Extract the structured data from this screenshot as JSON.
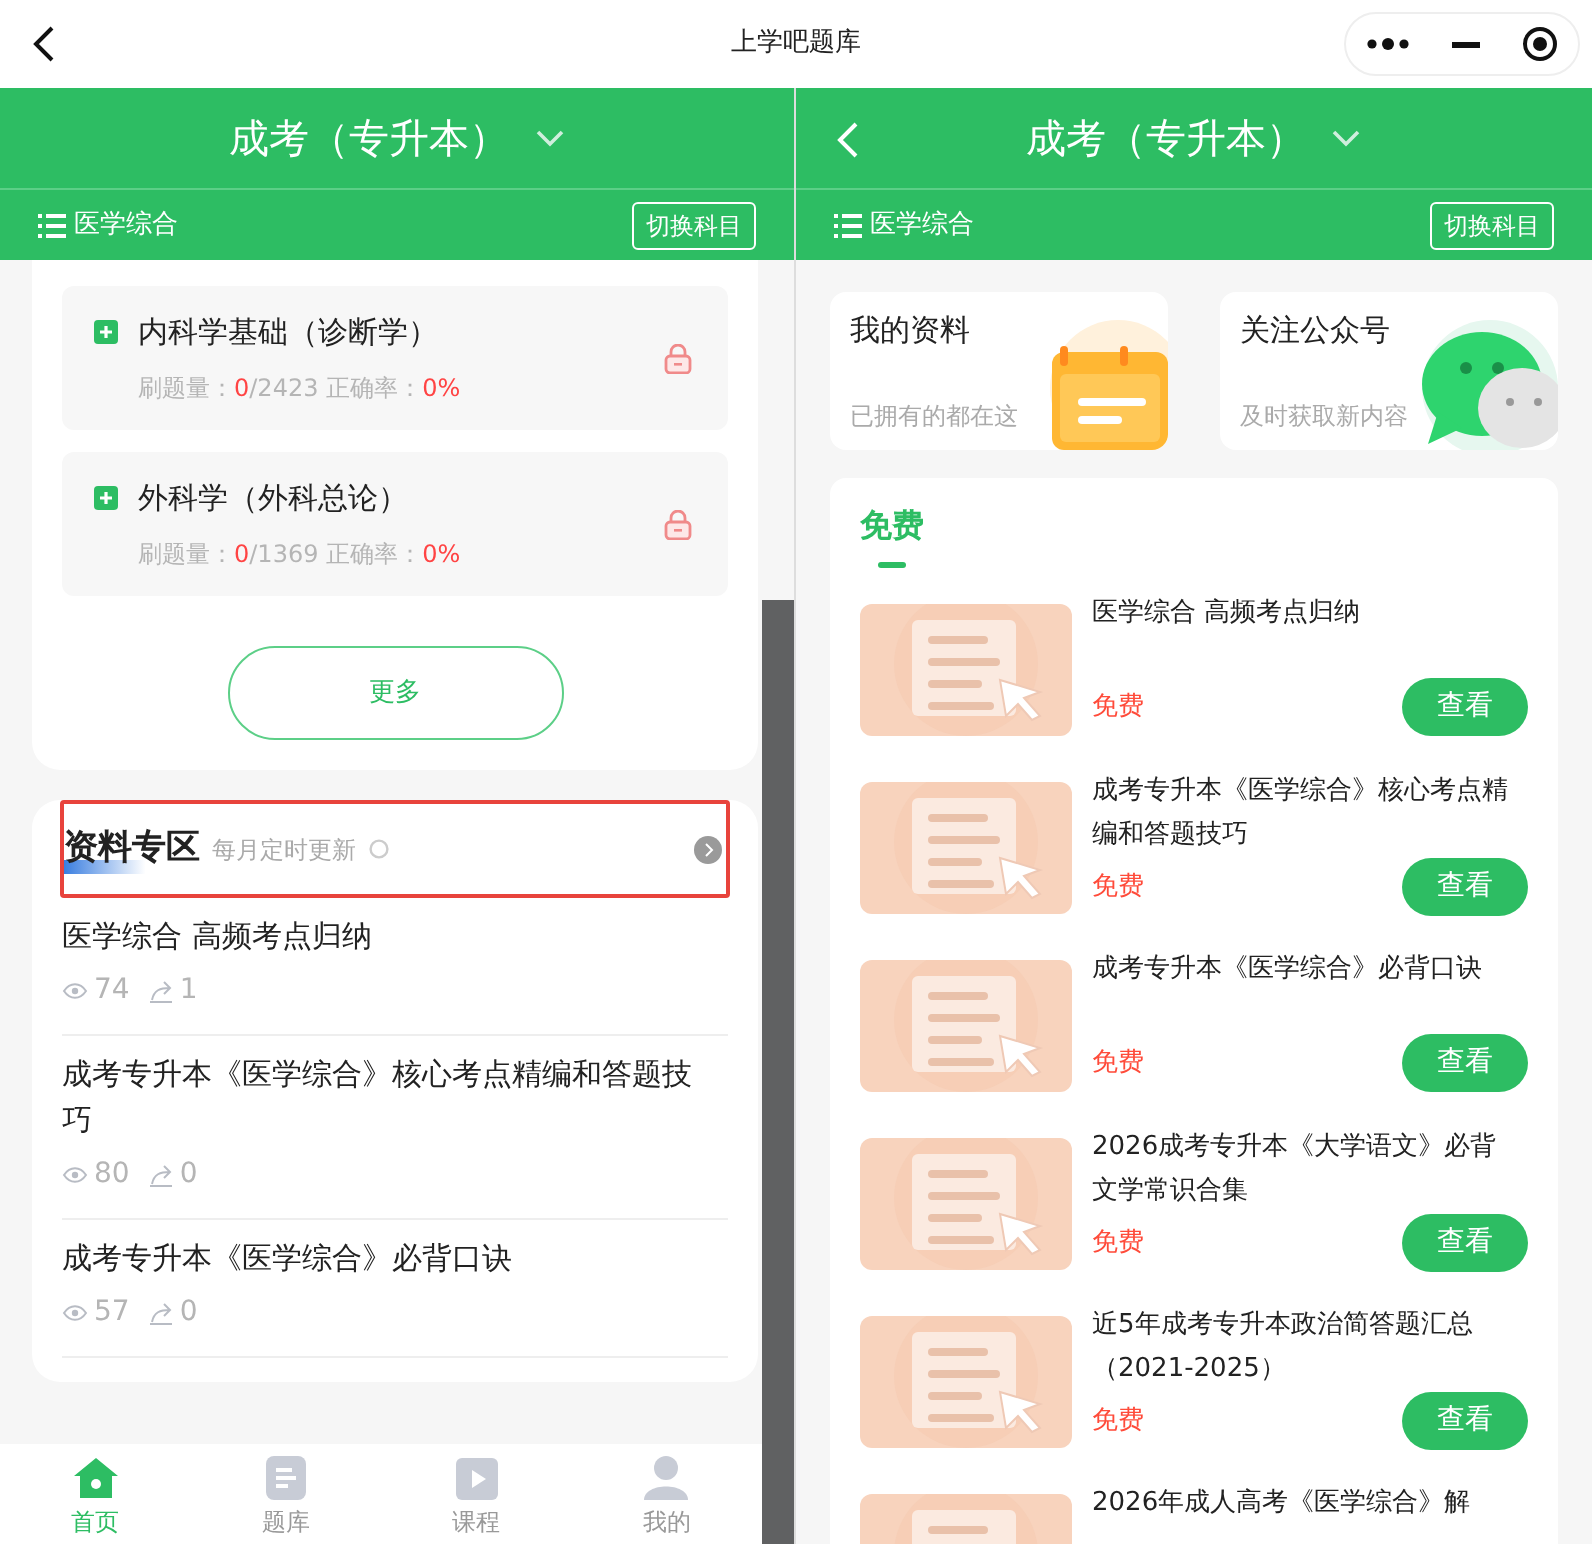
{
  "window": {
    "title": "上学吧题库"
  },
  "left_panel": {
    "header": {
      "title": "成考（专升本）"
    },
    "subject_bar": {
      "subject": "医学综合",
      "switch_button": "切换科目"
    },
    "courses": [
      {
        "name": "内科学基础（诊断学）",
        "progress_label": "刷题量：",
        "progress": "0",
        "total": "/2423",
        "accuracy_label": "正确率：",
        "accuracy": "0%",
        "locked": true
      },
      {
        "name": "外科学（外科总论）",
        "progress_label": "刷题量：",
        "progress": "0",
        "total": "/1369",
        "accuracy_label": "正确率：",
        "accuracy": "0%",
        "locked": true
      }
    ],
    "more_button": "更多",
    "materials": {
      "title": "资料专区",
      "subtitle": "每月定时更新",
      "highlighted": true,
      "items": [
        {
          "title": "医学综合 高频考点归纳",
          "views": "74",
          "shares": "1"
        },
        {
          "title": "成考专升本《医学综合》核心考点精编和答题技巧",
          "views": "80",
          "shares": "0"
        },
        {
          "title": "成考专升本《医学综合》必背口诀",
          "views": "57",
          "shares": "0"
        }
      ]
    },
    "tab_bar": [
      {
        "label": "首页",
        "kind": "home",
        "selected": true
      },
      {
        "label": "题库",
        "kind": "bank",
        "selected": false
      },
      {
        "label": "课程",
        "kind": "course",
        "selected": false
      },
      {
        "label": "我的",
        "kind": "profile",
        "selected": false
      }
    ]
  },
  "right_panel": {
    "header": {
      "title": "成考（专升本）"
    },
    "subject_bar": {
      "subject": "医学综合",
      "switch_button": "切换科目"
    },
    "cards": [
      {
        "title": "我的资料",
        "subtitle": "已拥有的都在这",
        "kind": "calendar"
      },
      {
        "title": "关注公众号",
        "subtitle": "及时获取新内容",
        "kind": "chat"
      }
    ],
    "free_section": {
      "tab": "免费",
      "items": [
        {
          "title": "医学综合 高频考点归纳",
          "price": "免费",
          "button": "查看"
        },
        {
          "title": "成考专升本《医学综合》核心考点精编和答题技巧",
          "price": "免费",
          "button": "查看"
        },
        {
          "title": "成考专升本《医学综合》必背口诀",
          "price": "免费",
          "button": "查看"
        },
        {
          "title": "2026成考专升本《大学语文》必背文学常识合集",
          "price": "免费",
          "button": "查看"
        },
        {
          "title": "近5年成考专升本政治简答题汇总（2021-2025）",
          "price": "免费",
          "button": "查看"
        },
        {
          "title": "2026年成人高考《医学综合》解"
        }
      ]
    }
  }
}
